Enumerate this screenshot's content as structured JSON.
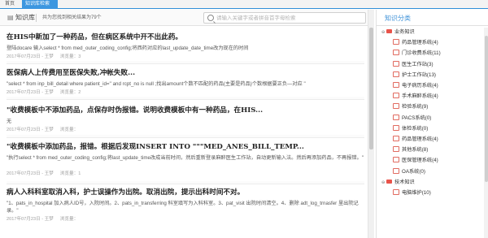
{
  "tabs": {
    "home": "首页",
    "active": "知识库检索"
  },
  "toolbar": {
    "title": "知识库",
    "result_count": "共为您找到相关结果为79个",
    "search_placeholder": "请输入关键字或者拼音首字母检索"
  },
  "articles": [
    {
      "title": "在HIS中新加了一种药品，但在病区系统中开不出此药。",
      "body": "登陆docare 输入select * from med_outer_coding_config;将西药对应的last_update_date_time改为现在的时间",
      "time": "2017年07月23日 - 王梦",
      "views": "浏览量：3"
    },
    {
      "title": "医保病人上传费用至医保失败,冲帐失败...",
      "body": "\"select * from inp_bill_detail where patient_id='' and rcpt_no is null ;找出amount个数不匹配的药品(主要是药品)个数根据要正负—对应 \"",
      "time": "2017年07月23日 - 王梦",
      "views": "浏览量：2"
    },
    {
      "title": "\"收费模板中不添加药品，点保存时伪报错。说明收费模板中有一种药品，在HIS...",
      "body": "无",
      "time": "2017年07月23日 - 王梦",
      "views": "浏览量："
    },
    {
      "title": "\"收费模板中添加药品，报错。根据后发现INSERT INTO \"\"\"MED_ANES_BILL_TEMP...",
      "body": "\"执行select * from med_outer_coding_config;将last_update_time改成当前时间，然后重新登录麻醉医生工作站，自动更新输入法。然后再添加药品，不再报错。\"",
      "time": "2017年07月23日 - 王梦",
      "views": "浏览量：1"
    },
    {
      "title": "病人入科科室取消入科，护士误操作为出院。取消出院，提示出科时间不对。",
      "body": "\"1、pats_in_hospital 加入病人ID号，入院时间。2、pats_in_transferring 科室填写为入科科室。3、pat_visit 出院时间清空。4、删除 adt_log_trnasfer 里出院记录。\"",
      "time": "2017年07月23日 - 王梦",
      "views": "浏览量："
    }
  ],
  "sidebar": {
    "title": "知识分类",
    "tree": [
      {
        "label": "业务知识",
        "level": 0,
        "toggle": "⊖"
      },
      {
        "label": "药品管理系统(4)",
        "level": 1
      },
      {
        "label": "门诊收费系统(11)",
        "level": 1
      },
      {
        "label": "医生工作站(3)",
        "level": 1
      },
      {
        "label": "护士工作站(13)",
        "level": 1
      },
      {
        "label": "电子病历系统(4)",
        "level": 1
      },
      {
        "label": "手术麻醉系统(4)",
        "level": 1
      },
      {
        "label": "检验系统(9)",
        "level": 1
      },
      {
        "label": "PACS系统(0)",
        "level": 1
      },
      {
        "label": "体检系统(0)",
        "level": 1
      },
      {
        "label": "药品管理系统(4)",
        "level": 1
      },
      {
        "label": "其他系统(8)",
        "level": 1
      },
      {
        "label": "医保管理系统(4)",
        "level": 1
      },
      {
        "label": "OA系统(0)",
        "level": 1
      },
      {
        "label": "技术知识",
        "level": 0,
        "toggle": "⊖"
      },
      {
        "label": "电脑维护(10)",
        "level": 1
      }
    ]
  }
}
